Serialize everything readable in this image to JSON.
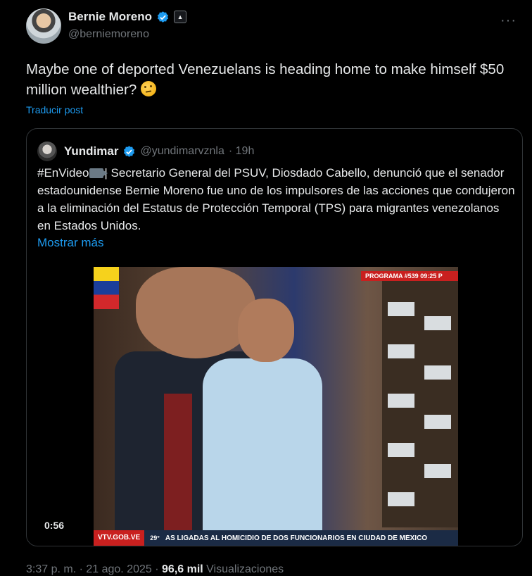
{
  "post": {
    "display_name": "Bernie Moreno",
    "handle": "@berniemoreno",
    "text": "Maybe one of deported Venezuelans is heading home to make himself $50 million wealthier?",
    "translate_label": "Traducir post"
  },
  "quoted": {
    "display_name": "Yundimar",
    "handle": "@yundimarvznla",
    "time": "· 19h",
    "text_prefix": "#EnVideo",
    "text": "| Secretario General del PSUV, Diosdado Cabello, denunció que el senador estadounidense Bernie Moreno fue uno de los impulsores de las acciones que condujeron a la eliminación del Estatus de Protección Temporal (TPS) para migrantes venezolanos en Estados Unidos.",
    "show_more_label": "Mostrar más",
    "video": {
      "duration": "0:56",
      "program_label": "PROGRAMA #539   09:25 P",
      "source": "VTV.GOB.VE",
      "temperature": "29°",
      "headline": "AS LIGADAS AL HOMICIDIO DE DOS FUNCIONARIOS EN CIUDAD DE MÉXICO"
    }
  },
  "footer": {
    "timestamp": "3:37 p. m. · 21 ago. 2025 ·",
    "views_count": "96,6 mil",
    "views_label": "Visualizaciones"
  },
  "colors": {
    "accent": "#1d9bf0",
    "background": "#000000",
    "border": "#2f3336",
    "secondary_text": "#71767b"
  }
}
